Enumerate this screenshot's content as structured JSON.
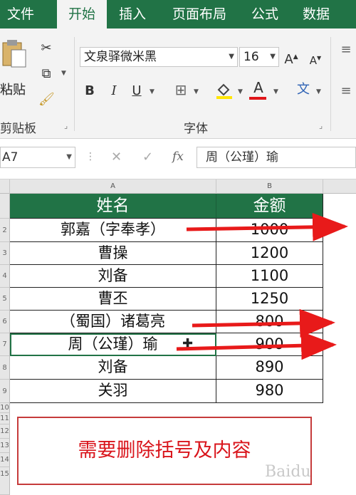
{
  "ribbon": {
    "tabs": [
      "文件",
      "开始",
      "插入",
      "页面布局",
      "公式",
      "数据"
    ],
    "active_tab": "开始",
    "clipboard": {
      "paste_label": "粘贴",
      "group_label": "剪贴板"
    },
    "font": {
      "name": "文泉驿微米黑",
      "size": "16",
      "group_label": "字体"
    }
  },
  "formula_bar": {
    "name_box": "A7",
    "formula": "周（公瑾）瑜"
  },
  "sheet": {
    "columns": [
      "A",
      "B"
    ],
    "header": {
      "name": "姓名",
      "amount": "金额"
    },
    "rows": [
      {
        "name": "郭嘉（字奉孝）",
        "amount": "1000"
      },
      {
        "name": "曹操",
        "amount": "1200"
      },
      {
        "name": "刘备",
        "amount": "1100"
      },
      {
        "name": "曹丕",
        "amount": "1250"
      },
      {
        "name": "（蜀国）诸葛亮",
        "amount": "800"
      },
      {
        "name": "周（公瑾）瑜",
        "amount": "900"
      },
      {
        "name": "刘备",
        "amount": "890"
      },
      {
        "name": "关羽",
        "amount": "980"
      }
    ],
    "row_numbers": [
      "2",
      "3",
      "4",
      "5",
      "6",
      "7",
      "8",
      "9",
      "10",
      "11",
      "12",
      "13",
      "14",
      "15"
    ]
  },
  "callout": {
    "text": "需要删除括号及内容"
  },
  "watermark": {
    "text": "Baidu"
  },
  "colors": {
    "accent": "#217346",
    "arrow": "#e81a1a",
    "callout_text": "#d9141b"
  }
}
